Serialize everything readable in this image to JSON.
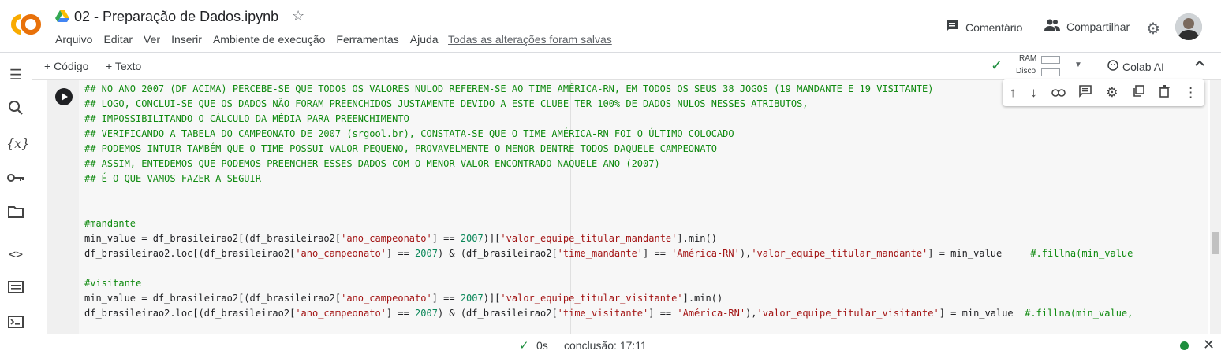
{
  "colors": {
    "accent": "#f9ab00",
    "check": "#1e8e3e",
    "comment": "#0f8a0f",
    "string": "#a31515",
    "number": "#098658",
    "status_dot": "#1e8e3e"
  },
  "header": {
    "title": "02 - Preparação de Dados.ipynb",
    "menu": [
      "Arquivo",
      "Editar",
      "Ver",
      "Inserir",
      "Ambiente de execução",
      "Ferramentas",
      "Ajuda"
    ],
    "saved": "Todas as alterações foram salvas",
    "comment_label": "Comentário",
    "share_label": "Compartilhar"
  },
  "toolbar": {
    "code_label": "+ Código",
    "text_label": "+ Texto",
    "ram_label": "RAM",
    "disk_label": "Disco",
    "colab_ai_label": "Colab AI"
  },
  "rail_icons": [
    "toc-icon",
    "search-icon",
    "variables-icon",
    "key-icon",
    "folder-icon",
    "code-snippets-icon",
    "command-palette-icon",
    "terminal-icon"
  ],
  "cell_tools_icons": [
    "arrow-up-icon",
    "arrow-down-icon",
    "link-icon",
    "comment-icon",
    "gear-icon",
    "mirror-icon",
    "delete-icon",
    "more-icon"
  ],
  "code_lines": [
    "## NO ANO 2007 (DF ACIMA) PERCEBE-SE QUE TODOS OS VALORES NULOD REFEREM-SE AO TIME AMÉRICA-RN, EM TODOS OS SEUS 38 JOGOS (19 MANDANTE E 19 VISITANTE)",
    "## LOGO, CONCLUI-SE QUE OS DADOS NÃO FORAM PREENCHIDOS JUSTAMENTE DEVIDO A ESTE CLUBE TER 100% DE DADOS NULOS NESSES ATRIBUTOS,",
    "## IMPOSSIBILITANDO O CÁLCULO DA MÉDIA PARA PREENCHIMENTO",
    "## VERIFICANDO A TABELA DO CAMPEONATO DE 2007 (srgool.br), CONSTATA-SE QUE O TIME AMÉRICA-RN FOI O ÚLTIMO COLOCADO",
    "## PODEMOS INTUIR TAMBÉM QUE O TIME POSSUI VALOR PEQUENO, PROVAVELMENTE O MENOR DENTRE TODOS DAQUELE CAMPEONATO",
    "## ASSIM, ENTEDEMOS QUE PODEMOS PREENCHER ESSES DADOS COM O MENOR VALOR ENCONTRADO NAQUELE ANO (2007)",
    "## É O QUE VAMOS FAZER A SEGUIR",
    "",
    "",
    "#mandante",
    "min_value = df_brasileirao2[(df_brasileirao2['ano_campeonato'] == 2007)]['valor_equipe_titular_mandante'].min()",
    "df_brasileirao2.loc[(df_brasileirao2['ano_campeonato'] == 2007) & (df_brasileirao2['time_mandante'] == 'América-RN'),'valor_equipe_titular_mandante'] = min_value     #.fillna(min_value",
    "",
    "#visitante",
    "min_value = df_brasileirao2[(df_brasileirao2['ano_campeonato'] == 2007)]['valor_equipe_titular_visitante'].min()",
    "df_brasileirao2.loc[(df_brasileirao2['ano_campeonato'] == 2007) & (df_brasileirao2['time_visitante'] == 'América-RN'),'valor_equipe_titular_visitante'] = min_value  #.fillna(min_value,"
  ],
  "status": {
    "duration": "0s",
    "completion": "conclusão: 17:11"
  }
}
